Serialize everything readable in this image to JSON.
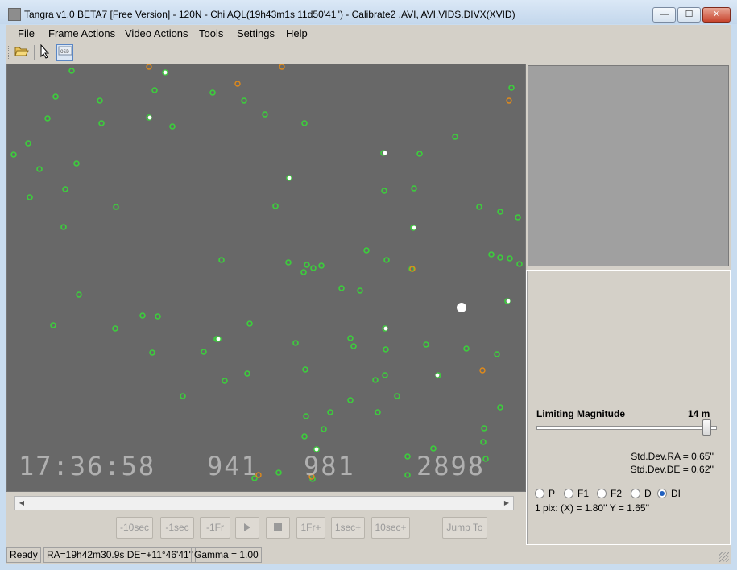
{
  "window": {
    "title": "Tangra v1.0 BETA7 [Free Version] - 120N - Chi AQL(19h43m1s 11d50'41'') - Calibrate2 .AVI, AVI.VIDS.DIVX(XVID)",
    "minimize_label": "—",
    "maximize_label": "☐",
    "close_label": "✕"
  },
  "menu": {
    "items": [
      "File",
      "Frame Actions",
      "Video Actions",
      "Tools",
      "Settings",
      "Help"
    ]
  },
  "toolbar": {
    "open_icon": "folder-open-icon",
    "pointer_icon": "cursor-arrow-icon",
    "osd_icon": "osd-icon"
  },
  "video": {
    "osd_time": "17:36:58",
    "osd_field1": "941",
    "osd_field2": "981",
    "osd_field3": "2898"
  },
  "playback": {
    "buttons": [
      "-10sec",
      "-1sec",
      "-1Fr",
      "",
      "",
      "1Fr+",
      "1sec+",
      "10sec+"
    ],
    "jump_label": "Jump To",
    "play_icon": "play-icon",
    "stop_icon": "stop-icon"
  },
  "astrometry": {
    "limiting_magnitude_label": "Limiting Magnitude",
    "limiting_magnitude_value": "14 m",
    "limiting_magnitude_slider_fraction": 1.0,
    "std_dev_ra": "Std.Dev.RA = 0.65''",
    "std_dev_de": "Std.Dev.DE = 0.62''",
    "radio_options": [
      "P",
      "F1",
      "F2",
      "D",
      "DI"
    ],
    "radio_selected": "DI",
    "pixel_scale": "1 pix: (X) = 1.80''  Y = 1.65''"
  },
  "status": {
    "state": "Ready",
    "coords": "RA=19h42m30.9s DE=+11°46'41\"",
    "gamma": "Gamma = 1.00"
  },
  "colors": {
    "star_marker": "#3ccf3c",
    "unmatched_marker": "#e08a1a",
    "video_background": "#686868"
  }
}
